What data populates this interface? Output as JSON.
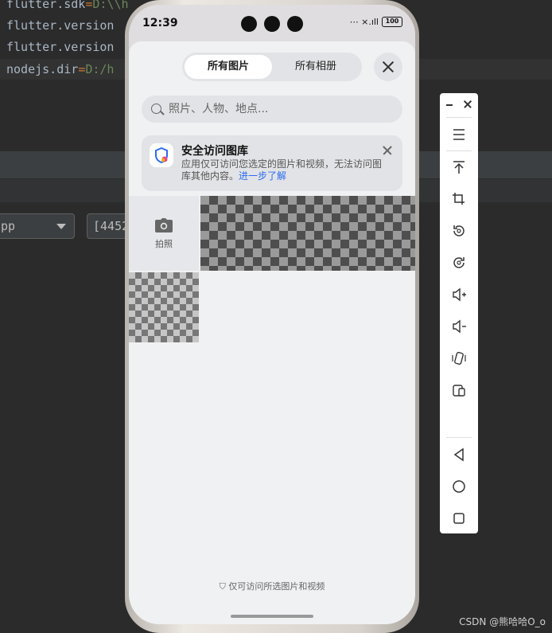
{
  "ide": {
    "code_lines": [
      {
        "key": "flutter.sdk",
        "eq": "=",
        "val": "D:\\\\h"
      },
      {
        "key": "flutter.version",
        "eq": "",
        "val": ""
      },
      {
        "key": "flutter.version",
        "eq": "",
        "val": ""
      },
      {
        "key": "nodejs.dir",
        "eq": "=",
        "val": "D:/h"
      }
    ],
    "device_select": "pp",
    "port_input": "[4452",
    "watermark": "CSDN @熊哈哈O_o"
  },
  "phone": {
    "status": {
      "time": "12:39",
      "battery": "100"
    },
    "picker": {
      "tabs": [
        {
          "label": "所有图片",
          "active": true
        },
        {
          "label": "所有相册",
          "active": false
        }
      ],
      "search_placeholder": "照片、人物、地点...",
      "notice": {
        "title": "安全访问图库",
        "body": "应用仅可访问您选定的图片和视频，无法访问图库其他内容。",
        "link": "进一步了解"
      },
      "camera_label": "拍照",
      "footer": "仅可访问所选图片和视频"
    }
  },
  "emulator_toolbar": {
    "buttons": [
      "menu-icon",
      "pin-top-icon",
      "crop-icon",
      "rotate-left-icon",
      "rotate-right-icon",
      "volume-up-icon",
      "volume-down-icon",
      "shake-icon",
      "screenshot-icon",
      "back-icon",
      "home-icon",
      "overview-icon"
    ]
  }
}
